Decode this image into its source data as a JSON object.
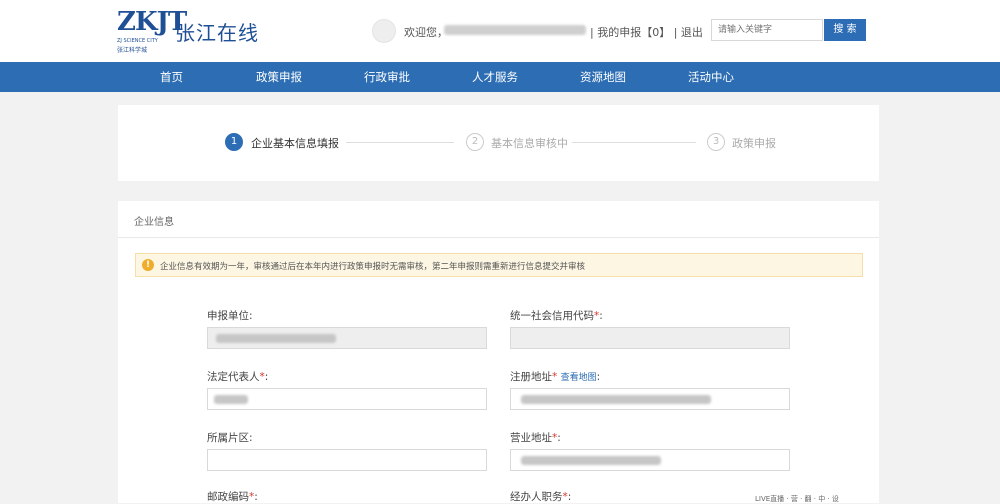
{
  "header": {
    "logo_mark": "ZKJT",
    "logo_en": "ZJ SCIENCE CITY",
    "logo_cn": "张江科学城",
    "site_title": "张江在线",
    "welcome": "欢迎您，",
    "my_apply": "我的申报【0】",
    "logout": "退出",
    "search_placeholder": "请输入关键字",
    "search_label": "搜 索"
  },
  "nav": {
    "items": [
      "首页",
      "政策申报",
      "行政审批",
      "人才服务",
      "资源地图",
      "活动中心"
    ]
  },
  "steps": [
    {
      "num": "1",
      "label": "企业基本信息填报",
      "state": "active"
    },
    {
      "num": "2",
      "label": "基本信息审核中",
      "state": "pending"
    },
    {
      "num": "3",
      "label": "政策申报",
      "state": "pending"
    }
  ],
  "form": {
    "title": "企业信息",
    "notice": "企业信息有效期为一年，审核通过后在本年内进行政策申报时无需审核，第二年申报则需重新进行信息提交并审核",
    "fields": {
      "applicant": {
        "label": "申报单位:"
      },
      "credit_code": {
        "label": "统一社会信用代码",
        "req": "*",
        "colon": ":"
      },
      "legal_rep": {
        "label": "法定代表人",
        "req": "*",
        "colon": ":"
      },
      "reg_address": {
        "label": "注册地址",
        "req": "*",
        "link": "查看地图",
        "colon": ":"
      },
      "district": {
        "label": "所属片区:"
      },
      "office_address": {
        "label": "营业地址",
        "req": "*",
        "colon": ":"
      },
      "row4_left": {
        "label": "邮政编码",
        "req": "*",
        "colon": ":"
      },
      "row4_right": {
        "label": "经办人职务",
        "req": "*",
        "colon": ":"
      }
    }
  },
  "statusbar": "LIVE直播 · 营 · 翻 · 中 · 设"
}
